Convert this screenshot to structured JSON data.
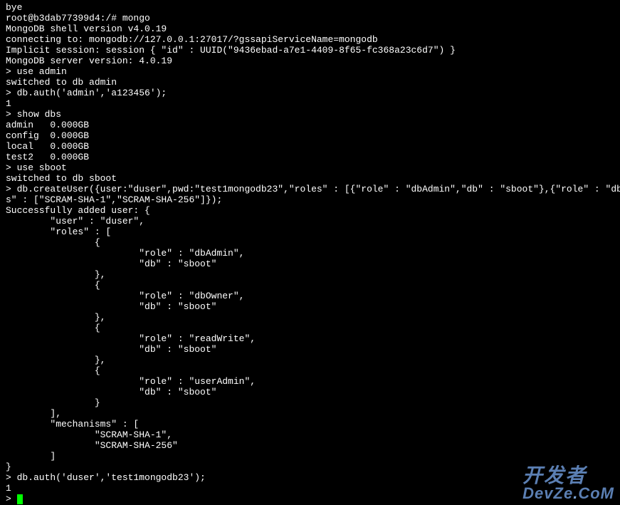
{
  "terminal": {
    "lines": [
      "bye",
      "root@b3dab77399d4:/# mongo",
      "MongoDB shell version v4.0.19",
      "connecting to: mongodb://127.0.0.1:27017/?gssapiServiceName=mongodb",
      "Implicit session: session { \"id\" : UUID(\"9436ebad-a7e1-4409-8f65-fc368a23c6d7\") }",
      "MongoDB server version: 4.0.19",
      "> use admin",
      "switched to db admin",
      "> db.auth('admin','a123456');",
      "1",
      "> show dbs",
      "admin   0.000GB",
      "config  0.000GB",
      "local   0.000GB",
      "test2   0.000GB",
      "> use sboot",
      "switched to db sboot",
      "> db.createUser({user:\"duser\",pwd:\"test1mongodb23\",\"roles\" : [{\"role\" : \"dbAdmin\",\"db\" : \"sboot\"},{\"role\" : \"dbOwner\",\"db\" :",
      "s\" : [\"SCRAM-SHA-1\",\"SCRAM-SHA-256\"]});",
      "Successfully added user: {",
      "        \"user\" : \"duser\",",
      "        \"roles\" : [",
      "                {",
      "                        \"role\" : \"dbAdmin\",",
      "                        \"db\" : \"sboot\"",
      "                },",
      "                {",
      "                        \"role\" : \"dbOwner\",",
      "                        \"db\" : \"sboot\"",
      "                },",
      "                {",
      "                        \"role\" : \"readWrite\",",
      "                        \"db\" : \"sboot\"",
      "                },",
      "                {",
      "                        \"role\" : \"userAdmin\",",
      "                        \"db\" : \"sboot\"",
      "                }",
      "        ],",
      "        \"mechanisms\" : [",
      "                \"SCRAM-SHA-1\",",
      "                \"SCRAM-SHA-256\"",
      "        ]",
      "}",
      "> db.auth('duser','test1mongodb23');",
      "1",
      "> "
    ],
    "prompt": "> "
  },
  "watermark": {
    "top": "开发者",
    "bottom_left": "DevZe",
    "bottom_dot": ".",
    "bottom_right": "CoM"
  }
}
